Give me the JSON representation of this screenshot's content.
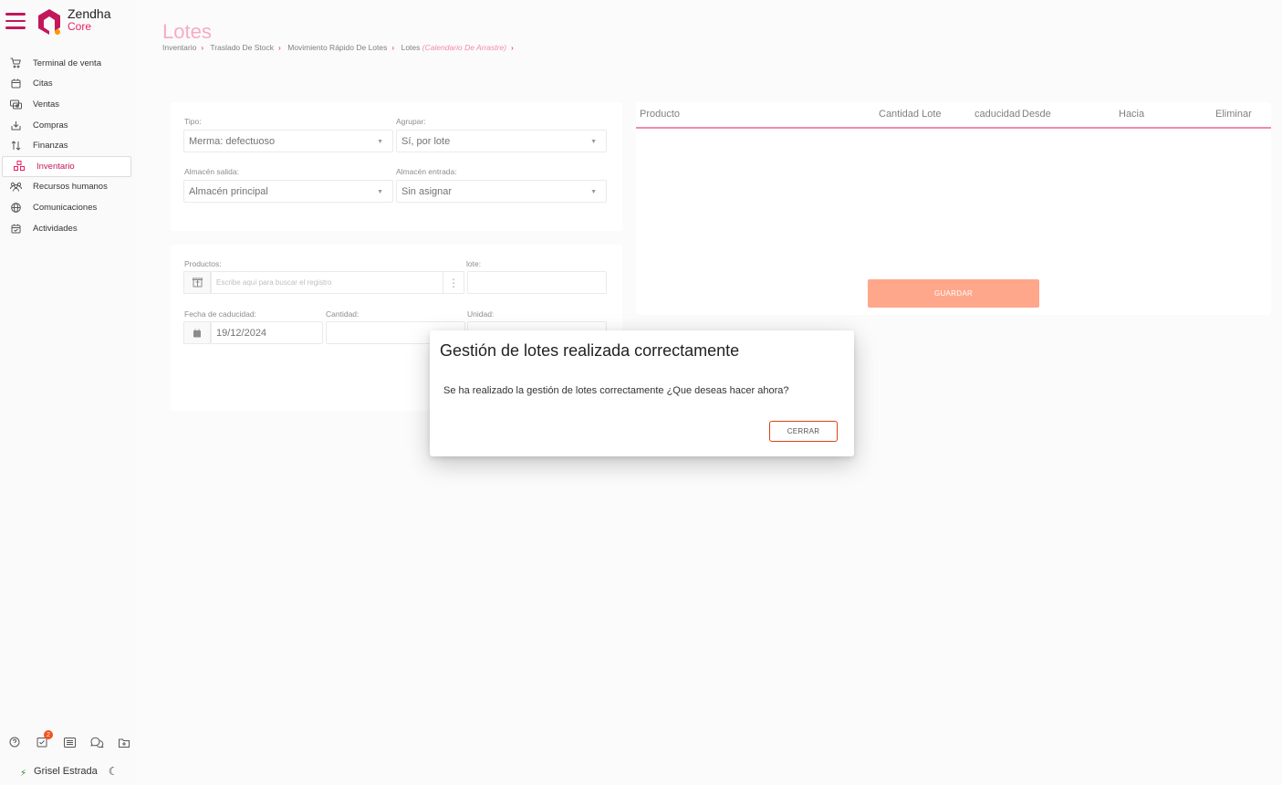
{
  "app": {
    "name": "Zendha",
    "sub": "Core"
  },
  "sidebar": {
    "items": [
      {
        "label": "Terminal de venta",
        "icon": "cart-icon"
      },
      {
        "label": "Citas",
        "icon": "calendar-icon"
      },
      {
        "label": "Ventas",
        "icon": "money-icon"
      },
      {
        "label": "Compras",
        "icon": "download-tray-icon"
      },
      {
        "label": "Finanzas",
        "icon": "arrows-updown-icon"
      },
      {
        "label": "Inventario",
        "icon": "boxes-icon",
        "active": true
      },
      {
        "label": "Recursos humanos",
        "icon": "people-icon"
      },
      {
        "label": "Comunicaciones",
        "icon": "globe-icon"
      },
      {
        "label": "Actividades",
        "icon": "calendar-check-icon"
      }
    ],
    "bottom": {
      "badge_count": "2"
    },
    "user": {
      "name": "Grisel Estrada"
    }
  },
  "header": {
    "title": "Lotes",
    "breadcrumb": [
      "Inventario",
      "Traslado De Stock",
      "Movimiento Rápido De Lotes",
      "Lotes"
    ],
    "breadcrumb_current": "(Calendario De Arrastre)"
  },
  "form": {
    "tipo_label": "Tipo:",
    "tipo_value": "Merma: defectuoso",
    "agrupar_label": "Agrupar:",
    "agrupar_value": "Sí, por lote",
    "almacen_salida_label": "Almacén salida:",
    "almacen_salida_value": "Almacén principal",
    "almacen_entrada_label": "Almacén entrada:",
    "almacen_entrada_value": "Sin asignar",
    "productos_label": "Productos:",
    "productos_placeholder": "Escribe aquí para buscar el registro",
    "lote_label": "lote:",
    "fecha_label": "Fecha de caducidad:",
    "fecha_value": "19/12/2024",
    "cantidad_label": "Cantidad:",
    "unidad_label": "Unidad:"
  },
  "table": {
    "columns": [
      "Producto",
      "Cantidad Lote",
      "caducidad",
      "Desde",
      "Hacia",
      "Eliminar"
    ],
    "save_label": "GUARDAR"
  },
  "modal": {
    "title": "Gestión de lotes realizada correctamente",
    "body": "Se ha realizado la gestión de lotes correctamente ¿Que deseas hacer ahora?",
    "close_label": "CERRAR"
  }
}
